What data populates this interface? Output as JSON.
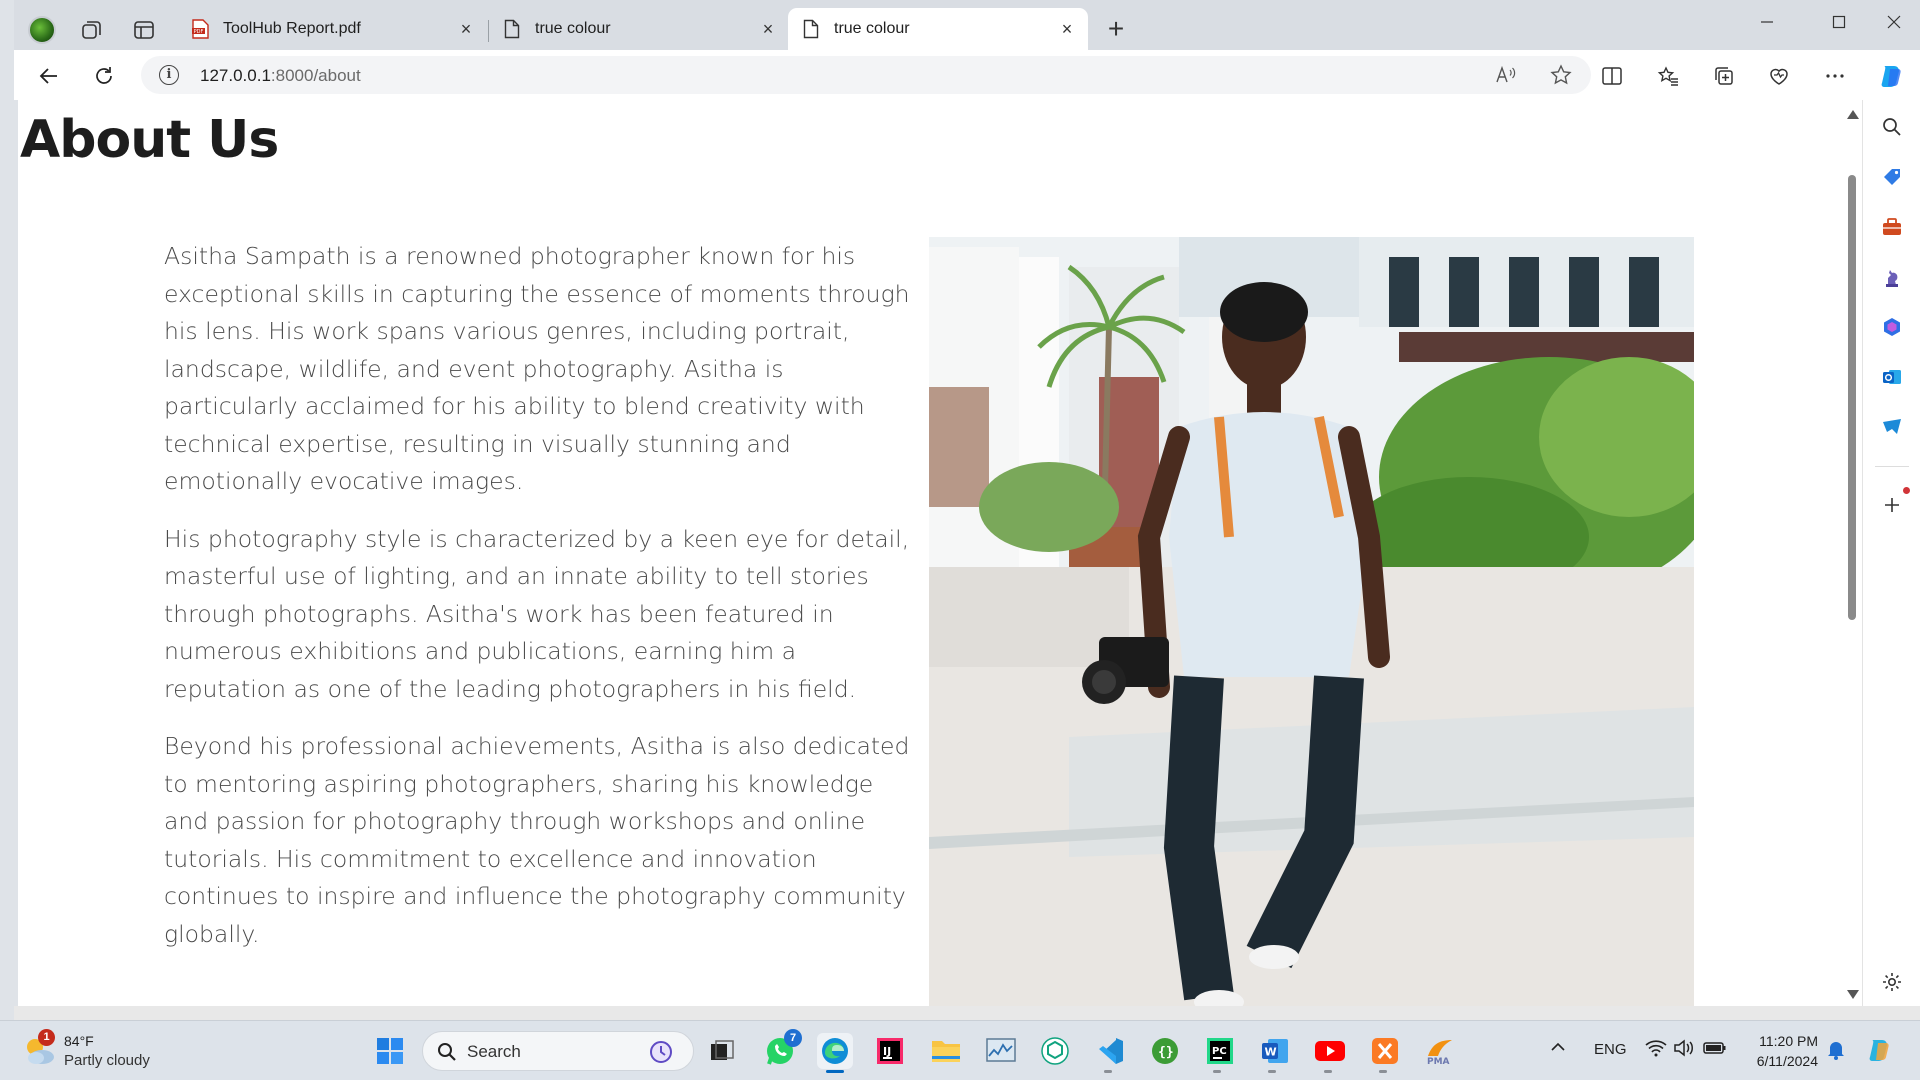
{
  "browser": {
    "tabs": [
      {
        "title": "ToolHub Report.pdf",
        "icon": "pdf-icon"
      },
      {
        "title": "true colour",
        "icon": "page-icon"
      },
      {
        "title": "true colour",
        "icon": "page-icon",
        "active": true
      }
    ],
    "new_tab_label": "+",
    "url_host": "127.0.0.1",
    "url_rest": ":8000/about"
  },
  "page": {
    "title": "About Us",
    "paragraphs": [
      "Asitha Sampath is a renowned photographer known for his exceptional skills in capturing the essence of moments through his lens. His work spans various genres, including portrait, landscape, wildlife, and event photography. Asitha is particularly acclaimed for his ability to blend creativity with technical expertise, resulting in visually stunning and emotionally evocative images.",
      "His photography style is characterized by a keen eye for detail, masterful use of lighting, and an innate ability to tell stories through photographs. Asitha's work has been featured in numerous exhibitions and publications, earning him a reputation as one of the leading photographers in his field.",
      "Beyond his professional achievements, Asitha is also dedicated to mentoring aspiring photographers, sharing his knowledge and passion for photography through workshops and online tutorials. His commitment to excellence and innovation continues to inspire and influence the photography community globally."
    ]
  },
  "taskbar": {
    "weather": {
      "temp": "84°F",
      "condition": "Partly cloudy",
      "badge": "1"
    },
    "search_label": "Search",
    "whatsapp_badge": "7",
    "tray_lang": "ENG",
    "time": "11:20 PM",
    "date": "6/11/2024"
  },
  "colors": {
    "tab_bar": "#d9dde3",
    "accent_blue": "#0078d4",
    "text_body": "#4a4a4a"
  }
}
